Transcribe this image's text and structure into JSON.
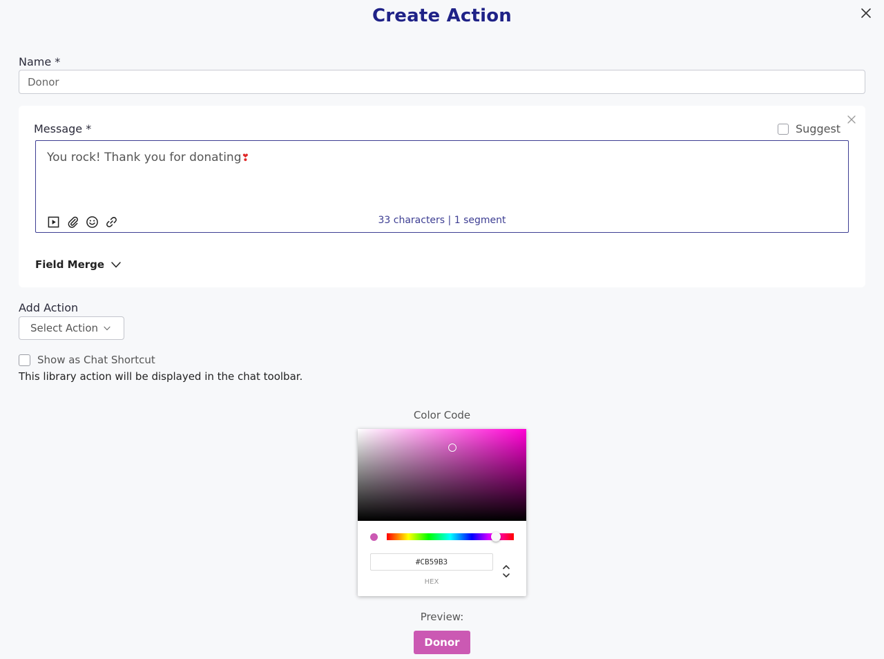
{
  "modal": {
    "title": "Create Action"
  },
  "name_field": {
    "label": "Name *",
    "value": "Donor"
  },
  "message": {
    "label": "Message *",
    "suggest_label": "Suggest",
    "text": "You rock! Thank you for donating",
    "emoji": "❣",
    "counter": "33 characters | 1 segment",
    "field_merge_label": "Field Merge",
    "toolbar_icons": [
      "video-icon",
      "attachment-icon",
      "emoji-icon",
      "link-icon"
    ]
  },
  "add_action": {
    "label": "Add Action",
    "select_label": "Select Action"
  },
  "chat_shortcut": {
    "label": "Show as Chat Shortcut",
    "checked": false,
    "description": "This library action will be displayed in the chat toolbar."
  },
  "color_picker": {
    "label": "Color Code",
    "hex_value": "#CB59B3",
    "hex_label": "HEX",
    "selected_color": "#CB59B3",
    "hue_color": "#ff00d4"
  },
  "preview": {
    "label": "Preview:",
    "chip_text": "Donor"
  },
  "colors": {
    "title": "#1f2287",
    "accent": "#3c3d92",
    "chip_bg": "#CB59B3"
  }
}
